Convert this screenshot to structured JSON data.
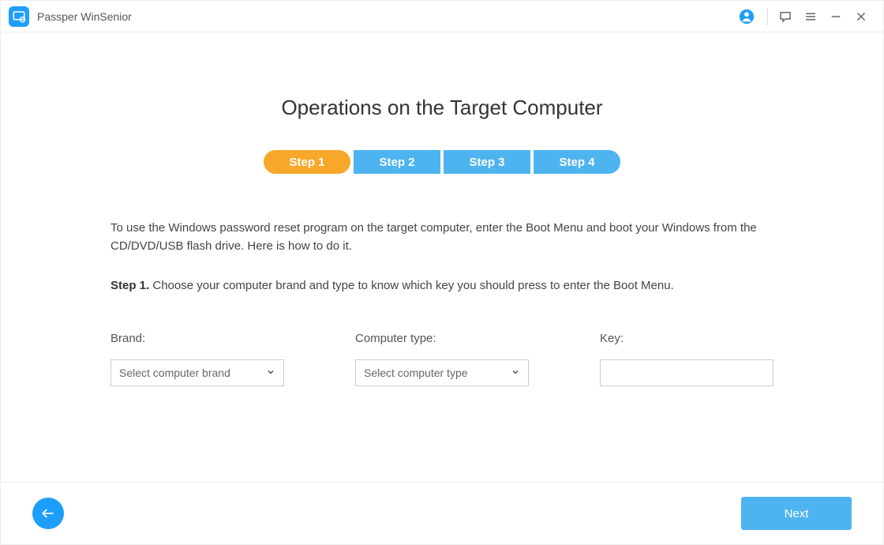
{
  "header": {
    "app_title": "Passper WinSenior"
  },
  "main": {
    "page_title": "Operations on the Target Computer",
    "steps": [
      {
        "label": "Step 1",
        "active": true
      },
      {
        "label": "Step 2",
        "active": false
      },
      {
        "label": "Step 3",
        "active": false
      },
      {
        "label": "Step 4",
        "active": false
      }
    ],
    "intro_text": "To use the Windows password reset program on the target computer, enter the Boot Menu and boot your Windows from the CD/DVD/USB flash drive. Here is how to do it.",
    "step1_prefix": "Step 1.",
    "step1_text": " Choose your computer brand and type to know which key you should press to enter the Boot Menu.",
    "form": {
      "brand_label": "Brand:",
      "brand_placeholder": "Select computer brand",
      "type_label": "Computer type:",
      "type_placeholder": "Select computer type",
      "key_label": "Key:",
      "key_value": ""
    }
  },
  "footer": {
    "next_label": "Next"
  }
}
